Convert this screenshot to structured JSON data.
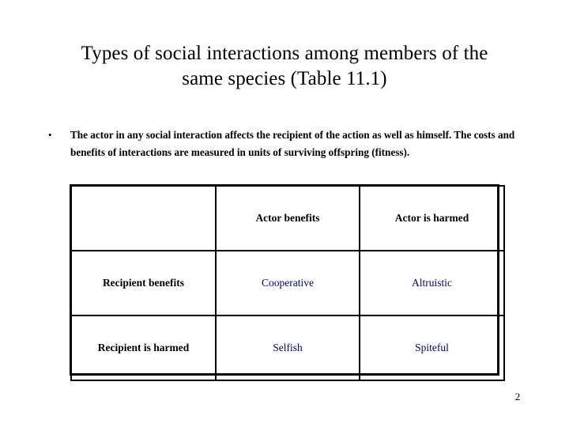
{
  "slide": {
    "background_color": "#ffffff",
    "page_number": "2"
  },
  "title": {
    "line1": "Types of social interactions among members of the",
    "line2": "same species (Table 11.1)",
    "full": "Types of social interactions among members of the same species (Table 11.1)",
    "color": "#000000"
  },
  "body": {
    "bullet_marker": "•",
    "bullet_text": "The actor in any social interaction affects the recipient of the action as well as himself.  The costs and benefits of interactions are measured in units of surviving offspring (fitness).",
    "lines": [
      "The actor in any social interaction affects the recipient of the action as well as",
      "himself.  The costs and benefits of interactions are measured in units of",
      "surviving offspring (fitness)."
    ]
  },
  "table": {
    "corner_label": "",
    "column_headers": [
      "Actor benefits",
      "Actor is harmed"
    ],
    "row_labels": [
      "Recipient benefits",
      "Recipient is harmed"
    ],
    "rows": [
      {
        "label": "Recipient benefits",
        "values": [
          "Cooperative",
          "Altruistic"
        ]
      },
      {
        "label": "Recipient is harmed",
        "values": [
          "Selfish",
          "Spiteful"
        ]
      }
    ],
    "header_color": "#000000",
    "value_color": "#000080",
    "border_color": "#000000"
  }
}
